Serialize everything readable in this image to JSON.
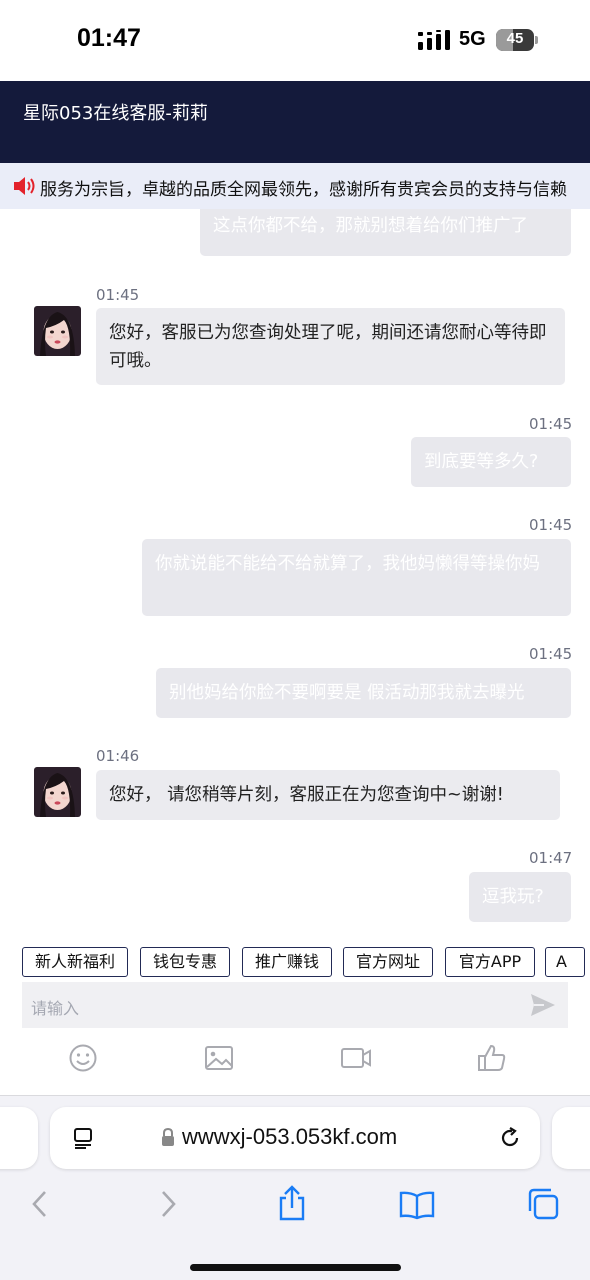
{
  "status_bar": {
    "time": "01:47",
    "network": "5G",
    "battery": "45",
    "battery_level": 0.45
  },
  "header": {
    "title": "星际053在线客服-莉莉"
  },
  "notice": {
    "text": "服务为宗旨，卓越的品质全网最领先，感谢所有贵宾会员的支持与信赖"
  },
  "messages": [
    {
      "side": "out",
      "time": "",
      "text": "这点你都不给，那就别想着给你们推广了"
    },
    {
      "side": "in",
      "time": "01:45",
      "text": "您好，客服已为您查询处理了呢，期间还请您耐心等待即可哦。"
    },
    {
      "side": "out",
      "time": "01:45",
      "text": "到底要等多久?"
    },
    {
      "side": "out",
      "time": "01:45",
      "text": "你就说能不能给不给就算了，我他妈懒得等操你妈"
    },
    {
      "side": "out",
      "time": "01:45",
      "text": "别他妈给你脸不要啊要是 假活动那我就去曝光"
    },
    {
      "side": "in",
      "time": "01:46",
      "text": "您好， 请您稍等片刻，客服正在为您查询中~谢谢!"
    },
    {
      "side": "out",
      "time": "01:47",
      "text": "逗我玩?"
    }
  ],
  "quick_tags": [
    "新人新福利",
    "钱包专惠",
    "推广赚钱",
    "官方网址",
    "官方APP",
    "A"
  ],
  "input": {
    "placeholder": "请输入"
  },
  "tools": [
    "emoji-icon",
    "image-icon",
    "video-icon",
    "thumbs-up-icon"
  ],
  "browser": {
    "url": "wwwxj-053.053kf.com"
  },
  "colors": {
    "header_bg": "#141a3b",
    "notice_bg": "#eaedf8",
    "bubble_bg": "#ebebef",
    "safari_blue": "#1a7cf5"
  }
}
